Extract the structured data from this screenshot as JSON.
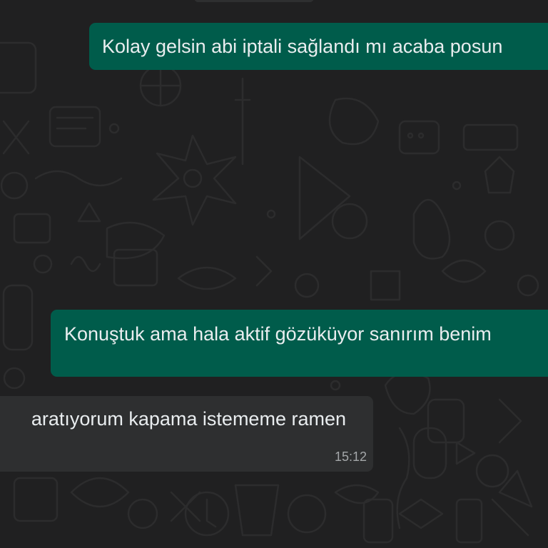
{
  "chat": {
    "messages": [
      {
        "direction": "outgoing",
        "text": "Kolay gelsin abi iptali sağlandı mı acaba posun"
      },
      {
        "direction": "outgoing",
        "text": "Konuştuk ama hala aktif gözüküyor sanırım benim"
      },
      {
        "direction": "incoming",
        "text": "aratıyorum kapama istememe ramen",
        "time": "15:12"
      }
    ]
  },
  "colors": {
    "background": "#202021",
    "outgoing_bubble": "#005c4b",
    "incoming_bubble": "#2e2f30",
    "text": "#e9edef",
    "timestamp": "#a4a7a9"
  }
}
